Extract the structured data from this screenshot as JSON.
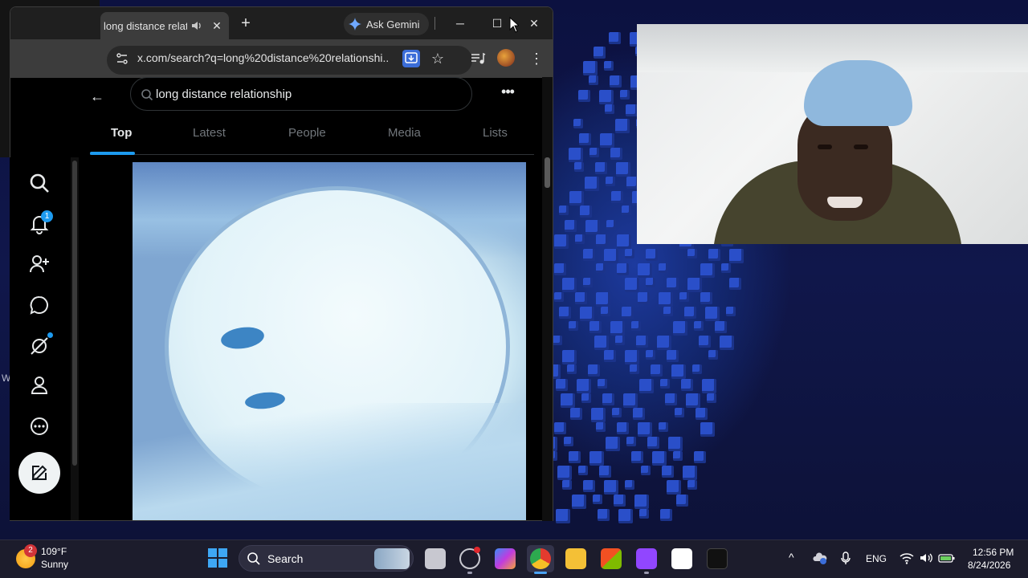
{
  "desktop": {
    "stray_text": "W"
  },
  "browser": {
    "tab": {
      "title": "long distance relationship"
    },
    "new_tab_symbol": "+",
    "gemini_label": "Ask Gemini",
    "address_url": "x.com/search?q=long%20distance%20relationshi...",
    "window_controls": {
      "minimize": "─",
      "maximize": "☐",
      "close": "✕"
    }
  },
  "x_page": {
    "search_query": "long distance relationship",
    "tabs": [
      {
        "label": "Top",
        "active": true
      },
      {
        "label": "Latest",
        "active": false
      },
      {
        "label": "People",
        "active": false
      },
      {
        "label": "Media",
        "active": false
      },
      {
        "label": "Lists",
        "active": false
      }
    ],
    "notifications_badge": "1",
    "left_nav_icons": [
      "search-icon",
      "bell-icon",
      "follow-icon",
      "messages-icon",
      "grok-icon",
      "profile-icon",
      "more-icon",
      "compose-icon"
    ]
  },
  "taskbar": {
    "weather": {
      "badge": "2",
      "temperature": "109°F",
      "condition": "Sunny"
    },
    "search_label": "Search",
    "tray": {
      "language": "ENG",
      "time": "12:56 PM",
      "date": "8/24/2026"
    }
  },
  "colors": {
    "x_accent": "#1d9bf0",
    "x_background": "#000000",
    "taskbar": "#1c1c2c",
    "wallpaper": "#10174b"
  }
}
